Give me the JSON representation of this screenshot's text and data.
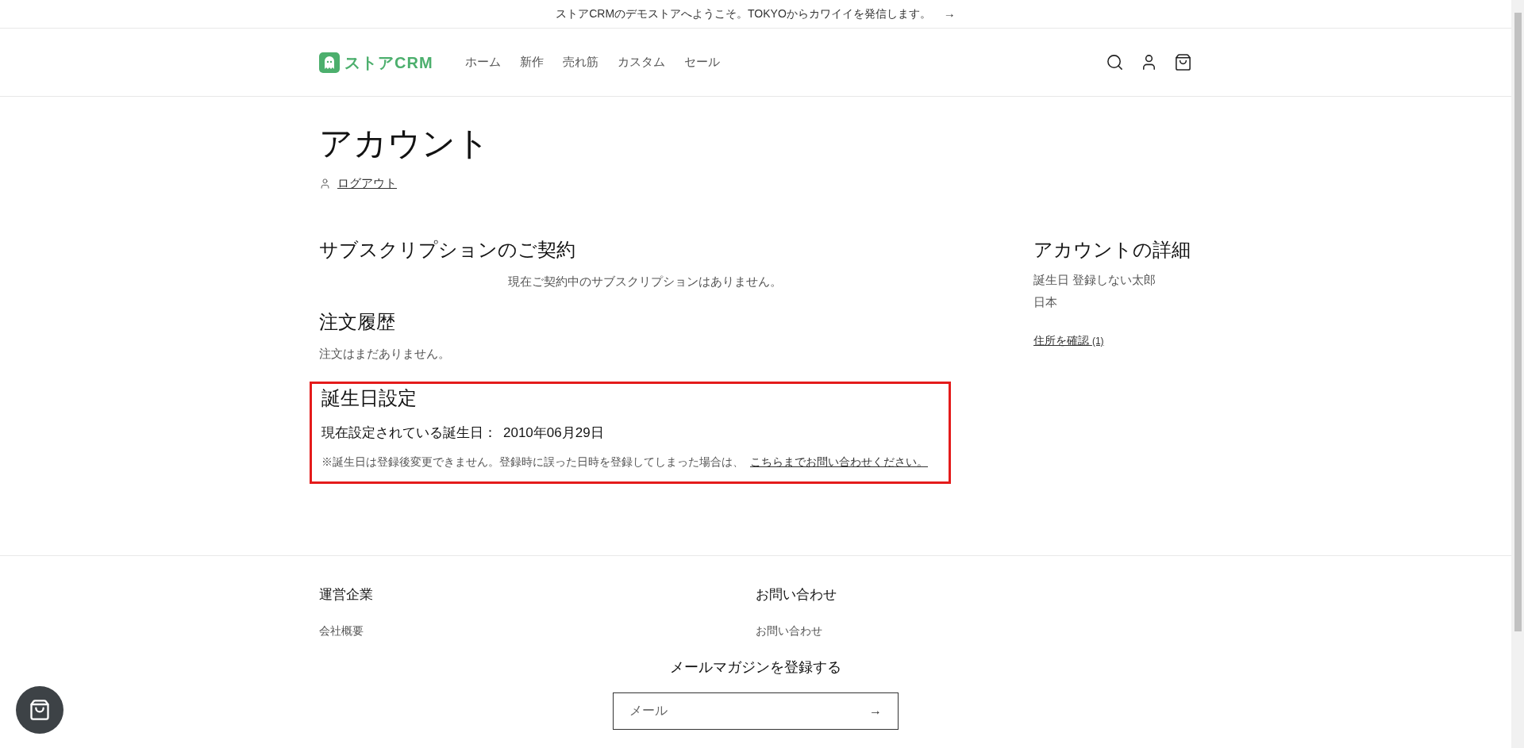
{
  "announcement": {
    "text": "ストアCRMのデモストアへようこそ。TOKYOからカワイイを発信します。",
    "arrow": "→"
  },
  "header": {
    "logo": "ストアCRM",
    "nav": [
      {
        "label": "ホーム"
      },
      {
        "label": "新作"
      },
      {
        "label": "売れ筋"
      },
      {
        "label": "カスタム"
      },
      {
        "label": "セール"
      }
    ]
  },
  "page": {
    "title": "アカウント",
    "logout": "ログアウト",
    "subscriptions": {
      "heading": "サブスクリプションのご契約",
      "empty": "現在ご契約中のサブスクリプションはありません。"
    },
    "orders": {
      "heading": "注文履歴",
      "empty": "注文はまだありません。"
    },
    "birthday": {
      "heading": "誕生日設定",
      "current_label": "現在設定されている誕生日：",
      "current_value": "2010年06月29日",
      "note": "※誕生日は登録後変更できません。登録時に誤った日時を登録してしまった場合は、",
      "contact_link": "こちらまでお問い合わせください。",
      "highlighted": true
    },
    "account_details": {
      "heading": "アカウントの詳細",
      "lines": [
        "誕生日 登録しない太郎",
        "日本"
      ],
      "addresses_link": "住所を確認",
      "addresses_count": "(1)"
    }
  },
  "footer": {
    "columns": [
      {
        "heading": "運営企業",
        "links": [
          "会社概要"
        ]
      },
      {
        "heading": "お問い合わせ",
        "links": [
          "お問い合わせ"
        ]
      }
    ],
    "newsletter": {
      "heading": "メールマガジンを登録する",
      "placeholder": "メール",
      "submit": "→"
    }
  }
}
